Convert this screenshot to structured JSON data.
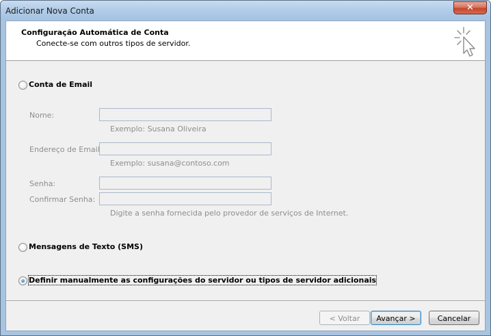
{
  "window": {
    "title": "Adicionar Nova Conta",
    "close_glyph": "✕"
  },
  "header": {
    "title": "Configuração Automática de Conta",
    "subtitle": "Conecte-se com outros tipos de servidor.",
    "icon": "cursor-click-icon"
  },
  "options": {
    "email": {
      "label": "Conta de Email",
      "selected": false
    },
    "sms": {
      "label": "Mensagens de Texto (SMS)",
      "selected": false
    },
    "manual": {
      "label": "Definir manualmente as configurações do servidor ou tipos de servidor adicionais",
      "selected": true
    }
  },
  "form": {
    "name_label": "Nome:",
    "name_value": "",
    "name_hint": "Exemplo: Susana Oliveira",
    "email_label": "Endereço de Email:",
    "email_value": "",
    "email_hint": "Exemplo: susana@contoso.com",
    "password_label": "Senha:",
    "password_value": "",
    "confirm_label": "Confirmar Senha:",
    "confirm_value": "",
    "password_hint": "Digite a senha fornecida pelo provedor de serviços de Internet."
  },
  "buttons": {
    "back": "< Voltar",
    "next": "Avançar >",
    "cancel": "Cancelar"
  },
  "colors": {
    "title_bar": "#b3cde8",
    "close_button": "#c3462c",
    "disabled_text": "#8d8d8d",
    "default_button_border": "#3c7fb1"
  }
}
